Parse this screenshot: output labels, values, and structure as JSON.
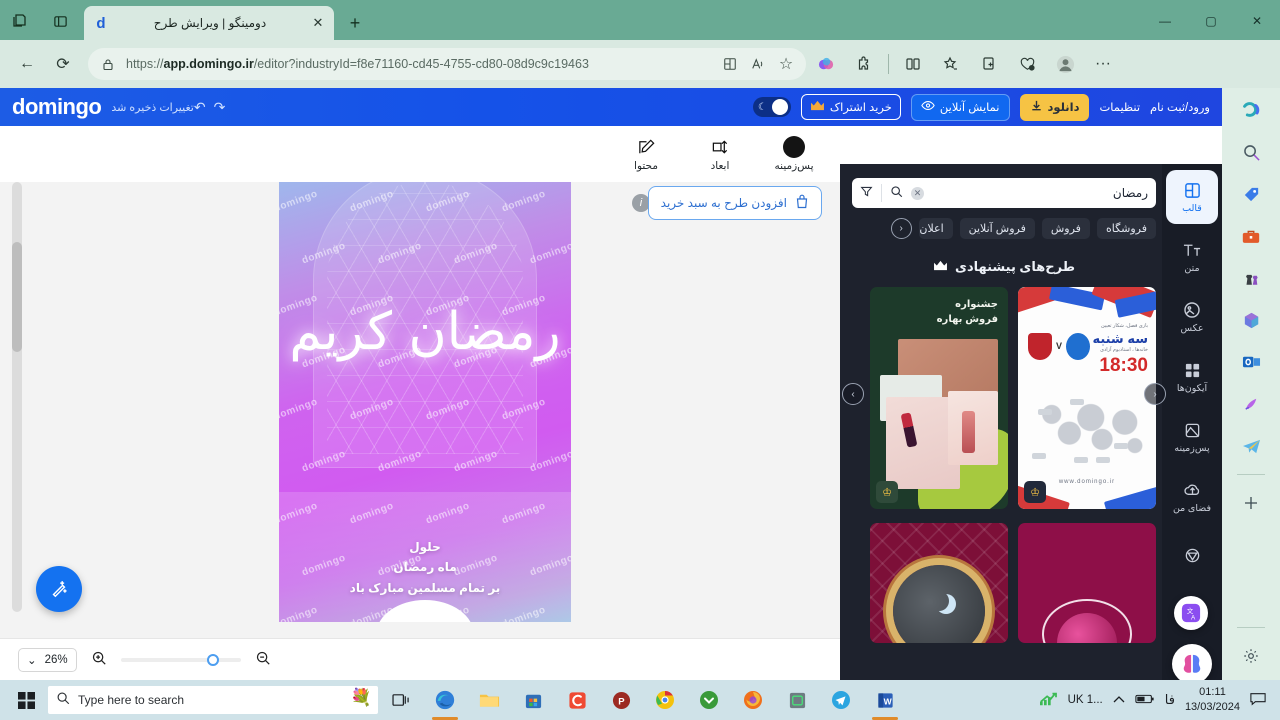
{
  "browser": {
    "tab": {
      "title": "دومینگو | ویرایش طرح",
      "favicon": "d",
      "close": "✕"
    },
    "new_tab": "+",
    "window_controls": {
      "minimize": "—",
      "maximize": "▢",
      "close": "✕"
    },
    "nav": {
      "back": "←",
      "reload": "⟳"
    },
    "url": {
      "lock_icon": "lock-icon",
      "prefix": "https://",
      "bold": "app.domingo.ir",
      "suffix": "/editor?industryId=f8e71160-cd45-4755-cd80-08d9c9c19463"
    },
    "url_actions": [
      {
        "name": "split-screen-icon",
        "glyph": "⊞"
      },
      {
        "name": "read-aloud-icon",
        "glyph": "A"
      },
      {
        "name": "favorite-star-icon",
        "glyph": "☆"
      }
    ],
    "toolbar_icons": [
      {
        "name": "copilot-icon",
        "glyph": "◕"
      },
      {
        "name": "extensions-puzzle-icon",
        "glyph": "✥"
      },
      {
        "name": "split-screen-icon",
        "glyph": "◫"
      },
      {
        "name": "favorites-icon",
        "glyph": "☆"
      },
      {
        "name": "collections-icon",
        "glyph": "⧉"
      },
      {
        "name": "browser-essentials-icon",
        "glyph": "♡"
      },
      {
        "name": "profile-avatar-icon",
        "glyph": "●"
      },
      {
        "name": "settings-more-icon",
        "glyph": "···"
      }
    ],
    "sidebar_icons": [
      {
        "name": "copilot-icon",
        "glyph": "◎"
      },
      {
        "name": "search-icon",
        "glyph": "🔍"
      },
      {
        "name": "shopping-tag-icon",
        "glyph": "🏷"
      },
      {
        "name": "tools-icon",
        "glyph": "🧰"
      },
      {
        "name": "games-icon",
        "glyph": "♟"
      },
      {
        "name": "microsoft365-icon",
        "glyph": "✿"
      },
      {
        "name": "outlook-icon",
        "glyph": "📧"
      },
      {
        "name": "designer-icon",
        "glyph": "🎨"
      },
      {
        "name": "telegram-icon",
        "glyph": "✈"
      },
      {
        "name": "add-sidebar-icon",
        "glyph": "+"
      },
      {
        "name": "sidebar-settings-icon",
        "glyph": "⚙"
      }
    ]
  },
  "app": {
    "logo": "domingo",
    "save_status": "تغییرات ذخیره شد",
    "undo": "↶",
    "redo": "↷",
    "dark_toggle": "dark-mode-toggle",
    "subscribe_button": "خرید اشتراک",
    "subscribe_icon": "crown-icon",
    "online_preview_button": "نمایش آنلاین",
    "online_preview_icon": "eye-icon",
    "download_button": "دانلود",
    "download_icon": "download-icon",
    "settings_link": "تنظیمات",
    "account_link": "ورود/ثبت نام",
    "colors": {
      "header_blue": "#1552e8",
      "accent_yellow": "#f6c344",
      "panel_dark": "#1e222d"
    }
  },
  "tools": [
    {
      "label": "پس‌زمینه",
      "icon": "color-swatch-icon"
    },
    {
      "label": "ابعاد",
      "icon": "resize-icon"
    },
    {
      "label": "محتوا",
      "icon": "edit-pencil-icon"
    }
  ],
  "canvas": {
    "add_to_cart_button": "افزودن طرح به سبد خرید",
    "cart_icon": "shopping-bag-icon",
    "info_icon": "info-icon",
    "poster": {
      "calligraphy": "رمضان کریم",
      "line1": "حلول",
      "line2": "ماه رمضان",
      "line3": "بر تمام مسلمین مبارک باد",
      "watermark": "domingo"
    },
    "collapse_handle": "▲",
    "magic_button": "magic-wand-icon"
  },
  "zoom_bar": {
    "level": "26%",
    "chevron": "⌄",
    "zoom_in_icon": "zoom-in-icon",
    "zoom_out_icon": "zoom-out-icon"
  },
  "right_panel": {
    "search": {
      "value": "رمضان",
      "clear_icon": "clear-x-icon",
      "search_icon": "search-icon",
      "filter_icon": "filter-icon"
    },
    "tags": [
      "فروشگاه",
      "فروش",
      "فروش آنلاین",
      "اعلان"
    ],
    "tag_prev_icon": "chevron-left-icon",
    "suggested_title": "طرح‌های پیشنهادی",
    "crown_icon": "crown-icon",
    "carousel_prev": "‹",
    "carousel_next": "›",
    "thumbnails": [
      {
        "name": "football-match-template",
        "day": "سه شنبه",
        "time": "18:30",
        "caption_top": "بازی فصل، شکار تعیین",
        "caption_sub": "خانه‌ها ، استادیوم آزادی",
        "vs": "V",
        "site": "www.domingo.ir",
        "pro_badge": "crown-icon"
      },
      {
        "name": "spring-sale-cosmetics-template",
        "title_line1": "جشنواره",
        "title_line2": "فروش بهاره",
        "pro_badge": "crown-icon"
      },
      {
        "name": "ramadan-crescent-template-1"
      },
      {
        "name": "ramadan-ornament-template-2"
      }
    ],
    "rail": [
      {
        "label": "قالب",
        "icon": "template-grid-icon",
        "active": true
      },
      {
        "label": "متن",
        "icon": "text-icon",
        "active": false
      },
      {
        "label": "عکس",
        "icon": "image-icon",
        "active": false
      },
      {
        "label": "آیکون‌ها",
        "icon": "icons-grid-icon",
        "active": false
      },
      {
        "label": "پس‌زمینه",
        "icon": "background-icon",
        "active": false
      },
      {
        "label": "فضای من",
        "icon": "cloud-upload-icon",
        "active": false
      },
      {
        "label": "",
        "icon": "more-icon",
        "active": false
      }
    ],
    "float_translate_icon": "translate-icon",
    "float_ai_icon": "ai-brain-icon"
  },
  "taskbar": {
    "start_icon": "windows-start-icon",
    "search_placeholder": "Type here to search",
    "search_icon": "search-icon",
    "decor_icon": "flowers-icon",
    "task_view_icon": "task-view-icon",
    "apps": [
      {
        "name": "edge-icon",
        "glyph": "◉",
        "active": true
      },
      {
        "name": "file-explorer-icon",
        "glyph": "📁",
        "active": false
      },
      {
        "name": "microsoft-store-icon",
        "glyph": "🛍",
        "active": false
      },
      {
        "name": "camtasia-icon",
        "glyph": "C",
        "active": false
      },
      {
        "name": "potplayer-icon",
        "glyph": "P",
        "active": false
      },
      {
        "name": "chrome-icon",
        "glyph": "◎",
        "active": false
      },
      {
        "name": "idm-icon",
        "glyph": "⬇",
        "active": false
      },
      {
        "name": "firefox-icon",
        "glyph": "🦊",
        "active": false
      },
      {
        "name": "notepad-icon",
        "glyph": "▤",
        "active": false
      },
      {
        "name": "telegram-icon",
        "glyph": "✈",
        "active": false
      },
      {
        "name": "word-icon",
        "glyph": "W",
        "active": true
      }
    ],
    "tray": {
      "network_label": "UK 1...",
      "network_icon": "signal-icon",
      "chevron_icon": "▲",
      "battery_icon": "battery-icon",
      "language": "فا",
      "time": "01:11",
      "date": "13/03/2024",
      "notification_icon": "notification-icon"
    }
  }
}
